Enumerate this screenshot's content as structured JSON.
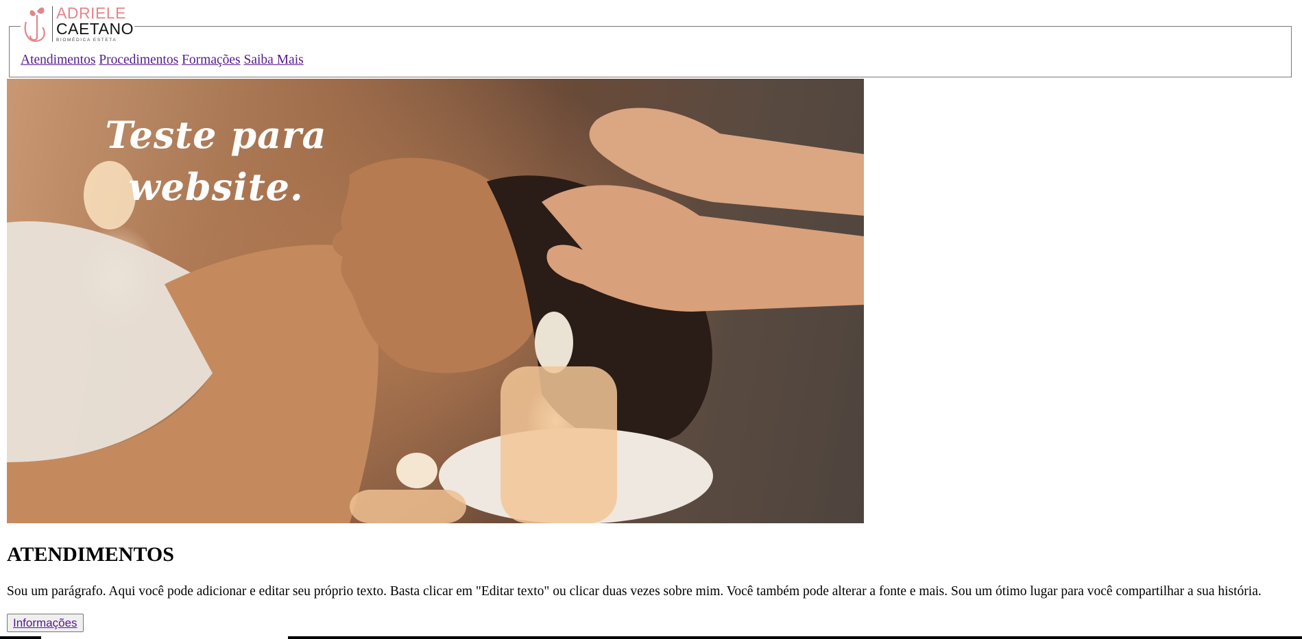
{
  "brand": {
    "name_line1": "ADRIELE",
    "name_line2": "CAETANO",
    "tagline": "BIOMÉDICA ESTETA",
    "accent_color": "#e4858b"
  },
  "nav": {
    "items": [
      {
        "label": "Atendimentos"
      },
      {
        "label": "Procedimentos"
      },
      {
        "label": "Formações"
      },
      {
        "label": "Saiba Mais"
      }
    ],
    "link_color": "#551a8b"
  },
  "hero": {
    "title_line1": "Teste para",
    "title_line2": "website.",
    "image": "spa-facial-massage-photo"
  },
  "section": {
    "title": "ATENDIMENTOS",
    "text": "Sou um parágrafo. Aqui você pode adicionar e editar seu próprio texto. Basta clicar em \"Editar texto\" ou clicar duas vezes sobre mim. Você também pode alterar a fonte e mais. Sou um ótimo lugar para você compartilhar a sua história.",
    "button_label": "Informações"
  }
}
